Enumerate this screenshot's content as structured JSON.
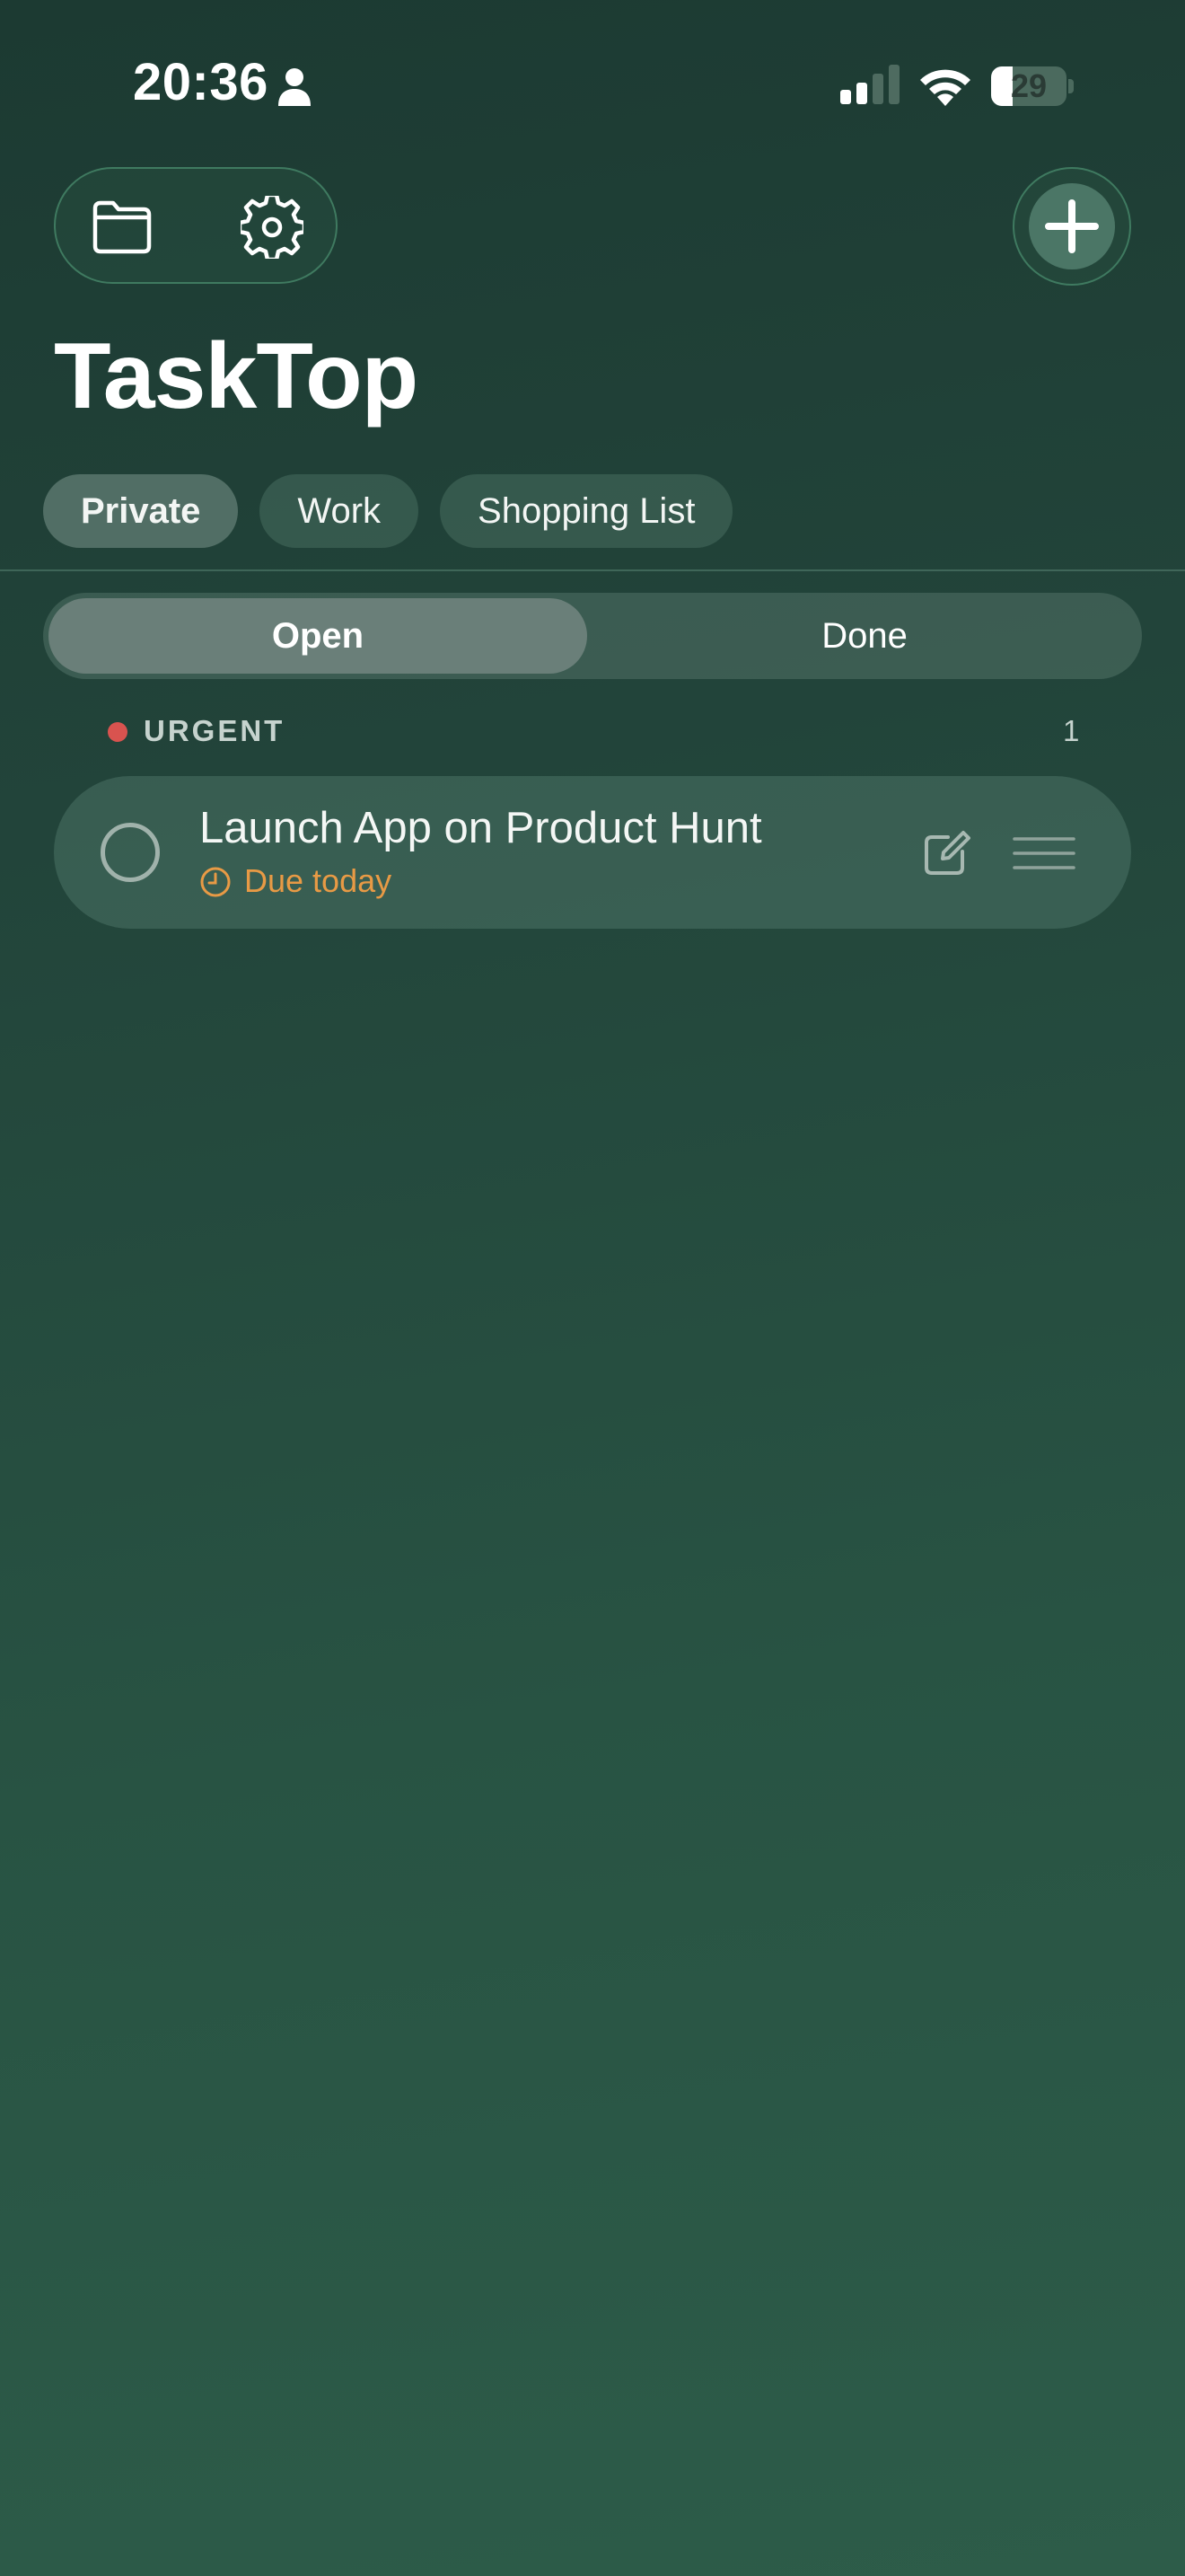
{
  "status_bar": {
    "time": "20:36",
    "battery_level": "29",
    "battery_fraction": 0.29,
    "icons": [
      "person-icon",
      "cellular-signal-icon",
      "wifi-icon",
      "battery-icon"
    ]
  },
  "toolbar": {
    "folder_icon": "folder-icon",
    "settings_icon": "gear-icon",
    "add_icon": "plus-icon"
  },
  "app": {
    "title": "TaskTop"
  },
  "lists": {
    "tabs": [
      {
        "label": "Private",
        "active": true
      },
      {
        "label": "Work",
        "active": false
      },
      {
        "label": "Shopping List",
        "active": false
      }
    ]
  },
  "filter": {
    "open_label": "Open",
    "done_label": "Done",
    "selected": "Open"
  },
  "section": {
    "label": "URGENT",
    "count": "1",
    "color": "#d9534f"
  },
  "tasks": [
    {
      "title": "Launch App on Product Hunt",
      "due": "Due today",
      "due_color": "#e89a45"
    }
  ],
  "colors": {
    "background_top": "#1c3a32",
    "background_bottom": "#2d5c49",
    "accent_border": "#3f7a60"
  }
}
